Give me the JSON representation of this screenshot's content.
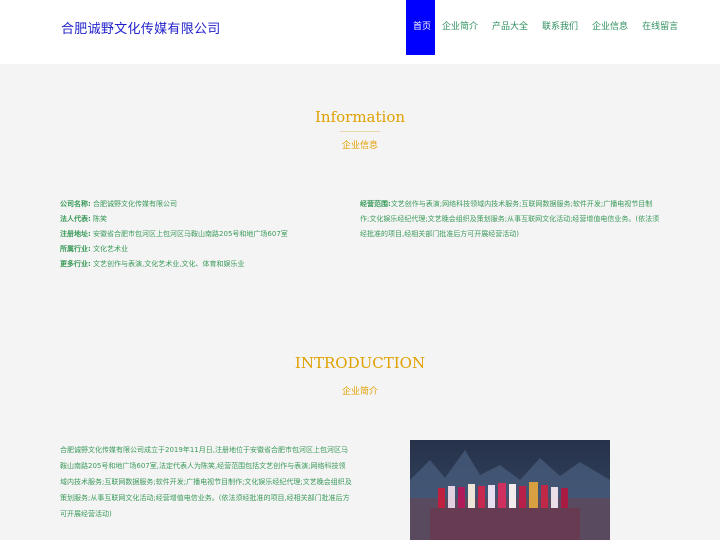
{
  "header": {
    "site_title": "合肥诚野文化传媒有限公司",
    "nav": [
      {
        "label": "首页",
        "active": true
      },
      {
        "label": "企业简介"
      },
      {
        "label": "产品大全"
      },
      {
        "label": "联系我们"
      },
      {
        "label": "企业信息"
      },
      {
        "label": "在线留言"
      }
    ]
  },
  "info_section": {
    "title": "Information",
    "subtitle": "企业信息",
    "left": [
      {
        "key": "公司名称:",
        "value": "合肥诚野文化传媒有限公司"
      },
      {
        "key": "法人代表:",
        "value": "陈笑"
      },
      {
        "key": "注册地址:",
        "value": "安徽省合肥市包河区上包河区马鞍山南路205号和地广场607室"
      },
      {
        "key": "所属行业:",
        "value": "文化艺术业"
      },
      {
        "key": "更多行业:",
        "value": "文艺创作与表演,文化艺术业,文化、体育和娱乐业"
      }
    ],
    "scope_key": "经营范围:",
    "scope_value": "文艺创作与表演;网络科技领域内技术服务;互联网数据服务;软件开发;广播电视节目制作;文化娱乐经纪代理;文艺晚会组织及策划服务;从事互联网文化活动;经营增值电信业务。(依法须经批准的项目,经相关部门批准后方可开展经营活动)"
  },
  "intro_section": {
    "title": "INTRODUCTION",
    "subtitle": "企业简介",
    "text": "合肥诚野文化传媒有限公司成立于2019年11月日,注册地位于安徽省合肥市包河区上包河区马鞍山南路205号和地广场607室,法定代表人为陈笑,经营范围包括文艺创作与表演;网络科技领域内技术服务;互联网数据服务;软件开发;广播电视节目制作;文化娱乐经纪代理;文艺晚会组织及策划服务;从事互联网文化活动;经营增值电信业务。(依法须经批准的项目,经相关部门批准后方可开展经营活动)"
  }
}
